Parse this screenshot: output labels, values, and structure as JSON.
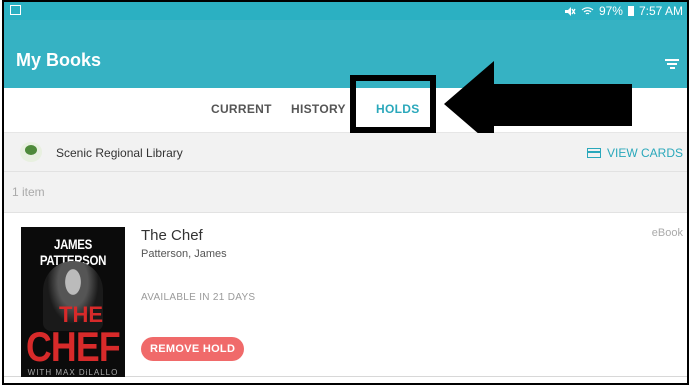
{
  "status_bar": {
    "battery": "97%",
    "time": "7:57 AM",
    "icons": [
      "image-icon",
      "mute-icon",
      "wifi-icon",
      "battery-icon"
    ]
  },
  "app_bar": {
    "title": "My Books",
    "menu_icon": "filter-icon",
    "color": "#36b2c3"
  },
  "tabs": {
    "current": "CURRENT",
    "history": "HISTORY",
    "holds": "HOLDS",
    "active": "holds",
    "accent": "#2aa8bb"
  },
  "annotation": {
    "highlight_target": "holds",
    "arrow_direction": "left"
  },
  "library": {
    "name": "Scenic Regional Library",
    "view_cards": "VIEW CARDS"
  },
  "list": {
    "count": "1 item"
  },
  "book": {
    "title": "The Chef",
    "author": "Patterson, James",
    "format": "eBook",
    "availability": "AVAILABLE IN 21 DAYS",
    "action": "REMOVE HOLD",
    "action_color": "#f06a6a",
    "cover": {
      "author_name": "JAMES PATTERSON",
      "title_line_1": "THE",
      "title_line_2": "CHEF",
      "coauthor": "WITH MAX DiLALLO"
    }
  }
}
